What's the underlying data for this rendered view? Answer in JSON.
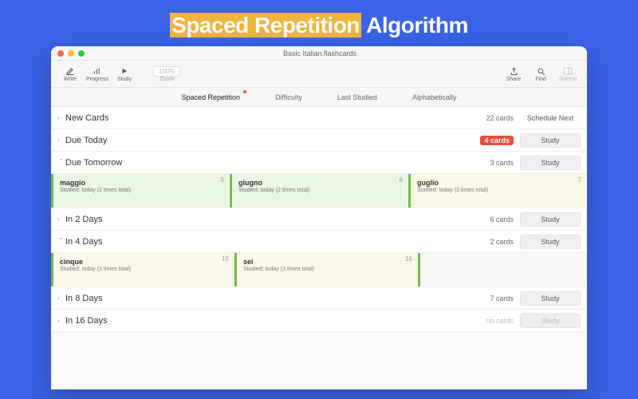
{
  "hero": {
    "highlight": "Spaced Repetition",
    "rest": " Algorithm"
  },
  "window": {
    "title": "Basic Italian.flashcards"
  },
  "toolbar": {
    "write": "Write",
    "progress": "Progress",
    "study": "Study",
    "zoom_label": "Zoom",
    "zoom_value": "100%",
    "share": "Share",
    "find": "Find",
    "sidebar": "Sidebar"
  },
  "tabs": {
    "spaced": "Spaced Repetition",
    "difficulty": "Difficulty",
    "last": "Last Studied",
    "alpha": "Alphabetically"
  },
  "sections": {
    "new": {
      "title": "New Cards",
      "count": "22 cards",
      "action": "Schedule Next"
    },
    "today": {
      "title": "Due Today",
      "count": "4 cards",
      "action": "Study"
    },
    "tomorrow": {
      "title": "Due Tomorrow",
      "count": "3 cards",
      "action": "Study"
    },
    "in2": {
      "title": "In 2 Days",
      "count": "6 cards",
      "action": "Study"
    },
    "in4": {
      "title": "In 4 Days",
      "count": "2 cards",
      "action": "Study"
    },
    "in8": {
      "title": "In 8 Days",
      "count": "7 cards",
      "action": "Study"
    },
    "in16": {
      "title": "In 16 Days",
      "count": "no cards",
      "action": "Study"
    }
  },
  "cards_tomorrow": [
    {
      "num": "5",
      "word": "maggio",
      "sub": "Studied: today (2 times total)",
      "bg": "green"
    },
    {
      "num": "6",
      "word": "giugno",
      "sub": "Studied: today (2 times total)",
      "bg": "green"
    },
    {
      "num": "7",
      "word": "guglio",
      "sub": "Studied: today (3 times total)",
      "bg": "cream"
    }
  ],
  "cards_in4": [
    {
      "num": "15",
      "word": "cinque",
      "sub": "Studied: today (3 times total)",
      "bg": "cream"
    },
    {
      "num": "16",
      "word": "sei",
      "sub": "Studied: today (3 times total)",
      "bg": "cream"
    }
  ]
}
